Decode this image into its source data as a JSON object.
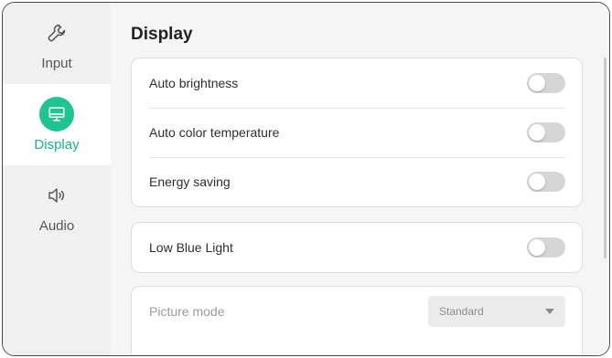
{
  "sidebar": {
    "items": [
      {
        "label": "Input",
        "icon": "wrench-icon"
      },
      {
        "label": "Display",
        "icon": "monitor-icon"
      },
      {
        "label": "Audio",
        "icon": "speaker-icon"
      }
    ],
    "active": "Display"
  },
  "main": {
    "title": "Display",
    "group1": [
      {
        "label": "Auto brightness",
        "state": "off"
      },
      {
        "label": "Auto color temperature",
        "state": "off"
      },
      {
        "label": "Energy saving",
        "state": "off"
      }
    ],
    "group2": [
      {
        "label": "Low Blue Light",
        "state": "off"
      }
    ],
    "picture_mode": {
      "label": "Picture mode",
      "value": "Standard"
    }
  },
  "colors": {
    "accent": "#20c493",
    "toggle_off": "#d6d6d6"
  }
}
